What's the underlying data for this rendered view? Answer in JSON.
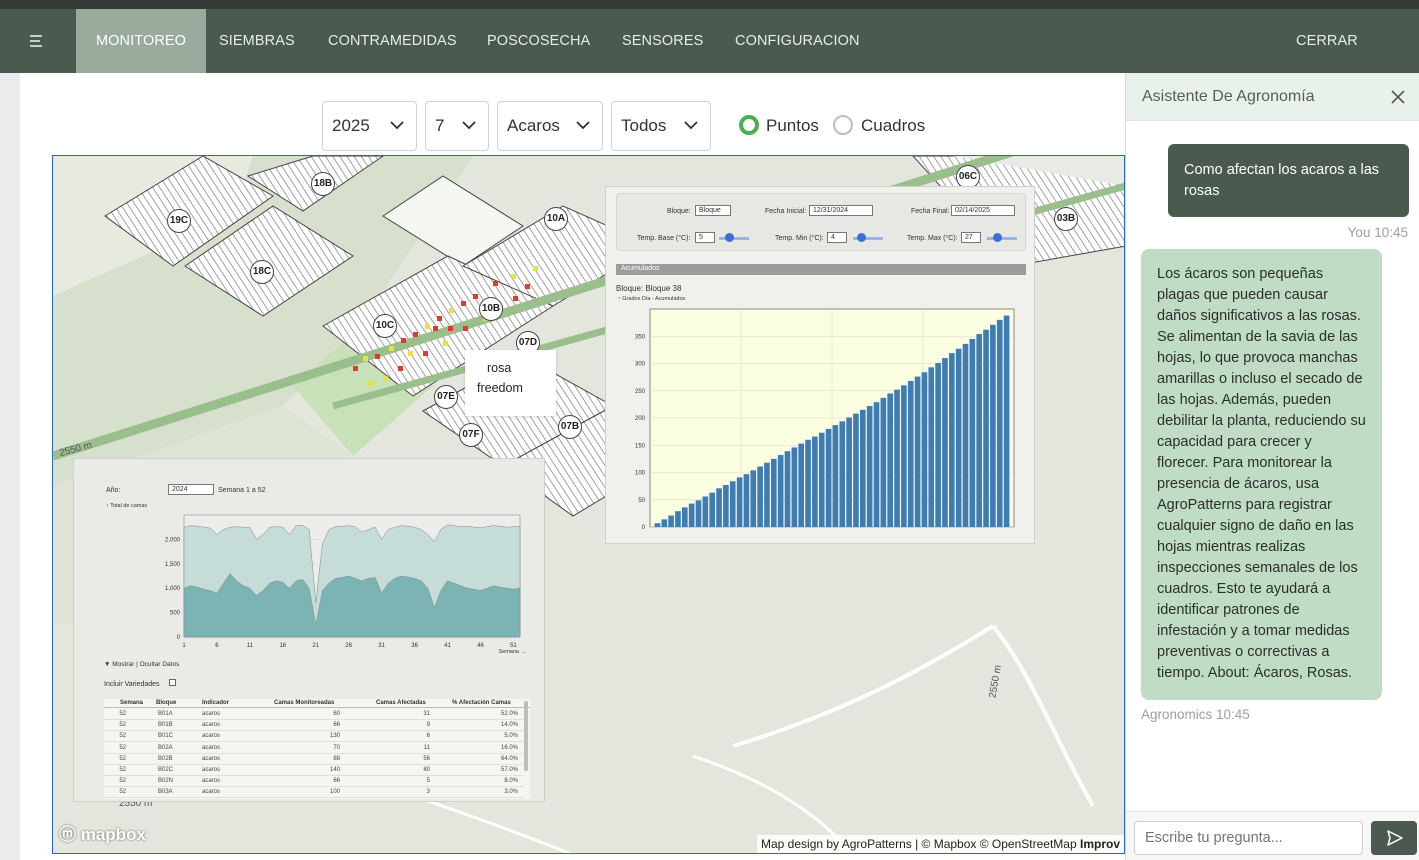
{
  "nav": {
    "menu_icon": "menu-icon",
    "items": [
      {
        "label": "MONITOREO",
        "active": true
      },
      {
        "label": "SIEMBRAS",
        "active": false
      },
      {
        "label": "CONTRAMEDIDAS",
        "active": false
      },
      {
        "label": "POSCOSECHA",
        "active": false
      },
      {
        "label": "SENSORES",
        "active": false
      },
      {
        "label": "CONFIGURACION",
        "active": false
      }
    ],
    "logout_label": "CERRAR SESION"
  },
  "filters": {
    "year": "2025",
    "week": "7",
    "pest": "Acaros",
    "scope": "Todos",
    "view_options": [
      {
        "label": "Puntos",
        "selected": true
      },
      {
        "label": "Cuadros",
        "selected": false
      }
    ]
  },
  "map": {
    "markers": [
      "18B",
      "19C",
      "18C",
      "10A",
      "10C",
      "10B",
      "07D",
      "07E",
      "07F",
      "07B",
      "06C",
      "03B"
    ],
    "popup": {
      "line1": "rosa",
      "line2": "freedom"
    },
    "elevation_labels": [
      "2550 m",
      "2550 m",
      "2550 m"
    ],
    "attribution": "Map design by AgroPatterns | © Mapbox © OpenStreetMap",
    "improve_label": "Improv",
    "logo": "mapbox"
  },
  "gdd_panel": {
    "block_label": "Bloque:",
    "block_value": "Bloque",
    "start_label": "Fecha Inicial:",
    "start_value": "12/31/2024",
    "end_label": "Fecha Final:",
    "end_value": "02/14/2025",
    "tbase_label": "Temp. Base (°C):",
    "tbase_value": "5",
    "tmin_label": "Temp. Min (°C):",
    "tmin_value": "4",
    "tmax_label": "Temp. Max (°C):",
    "tmax_value": "27",
    "section_title": "Acumulados",
    "chart_title": "Bloque: Bloque 38",
    "series_label": "Grados Día - Acumulados"
  },
  "table_panel": {
    "year_label": "Año:",
    "year_value": "2024",
    "range_label": "Semana 1 a 52",
    "series_label": "Total de camas",
    "xaxis_label": "Semana",
    "toggle_label": "Mostrar | Ocultar Datos",
    "include_label": "Incluir Variedades",
    "columns": [
      "Semana",
      "Bloque",
      "Indicador",
      "Camas Monitoreadas",
      "Camas Afectadas",
      "% Afectación Camas"
    ],
    "rows": [
      [
        "52",
        "B01A",
        "acaros",
        "60",
        "31",
        "52.0%"
      ],
      [
        "52",
        "B01B",
        "acaros",
        "66",
        "9",
        "14.0%"
      ],
      [
        "52",
        "B01C",
        "acaros",
        "130",
        "6",
        "5.0%"
      ],
      [
        "52",
        "B02A",
        "acaros",
        "70",
        "11",
        "16.0%"
      ],
      [
        "52",
        "B02B",
        "acaros",
        "88",
        "56",
        "64.0%"
      ],
      [
        "52",
        "B02C",
        "acaros",
        "140",
        "80",
        "57.0%"
      ],
      [
        "52",
        "B02N",
        "acaros",
        "66",
        "5",
        "8.0%"
      ],
      [
        "52",
        "B03A",
        "acaros",
        "100",
        "3",
        "3.0%"
      ]
    ]
  },
  "chart_data": [
    {
      "type": "bar",
      "title": "Bloque: Bloque 38",
      "series": [
        {
          "name": "Grados Día - Acumulados",
          "values": [
            7,
            14,
            21,
            29,
            36,
            43,
            49,
            56,
            63,
            71,
            77,
            84,
            91,
            97,
            104,
            111,
            118,
            125,
            132,
            139,
            146,
            153,
            160,
            166,
            173,
            180,
            187,
            194,
            201,
            208,
            215,
            222,
            229,
            237,
            245,
            252,
            260,
            268,
            276,
            284,
            293,
            301,
            310,
            319,
            327,
            336,
            345,
            354,
            362,
            371,
            380,
            388
          ]
        }
      ],
      "ylim": [
        0,
        400
      ],
      "yticks": [
        0,
        50,
        100,
        150,
        200,
        250,
        300,
        350
      ],
      "grid": true,
      "color": "#3f7cb6"
    },
    {
      "type": "area",
      "series": [
        {
          "name": "Total de camas",
          "values": [
            2250,
            2280,
            2270,
            2250,
            2230,
            2100,
            2200,
            2250,
            2260,
            2250,
            2240,
            2000,
            2100,
            2250,
            2260,
            2250,
            2100,
            2280,
            2290,
            2200,
            700,
            1900,
            2200,
            2260,
            2270,
            2280,
            2260,
            2150,
            2200,
            2250,
            2000,
            2200,
            2250,
            2280,
            2270,
            2250,
            2200,
            2100,
            1950,
            2200,
            2300,
            2280,
            2260,
            2270,
            2250,
            2240,
            2260,
            2280,
            2270,
            2250,
            2260,
            2270
          ]
        },
        {
          "values": [
            1000,
            1050,
            1020,
            980,
            950,
            900,
            1100,
            1300,
            1150,
            1050,
            1000,
            850,
            950,
            1100,
            1150,
            1120,
            1000,
            1150,
            1180,
            1000,
            250,
            950,
            1100,
            1200,
            1220,
            1250,
            1200,
            1150,
            1200,
            1220,
            900,
            1100,
            1200,
            1250,
            1230,
            1200,
            1150,
            1000,
            600,
            950,
            1150,
            1100,
            1050,
            1000,
            980,
            950,
            1000,
            1050,
            1020,
            1000,
            980,
            1000
          ]
        }
      ],
      "ylim": [
        0,
        2500
      ],
      "yticks": [
        "0",
        "500",
        "1,000",
        "1,500",
        "2,000"
      ],
      "xticks": [
        1,
        6,
        11,
        16,
        21,
        26,
        31,
        36,
        41,
        46,
        51
      ],
      "xlabel": "Semana"
    }
  ],
  "assistant": {
    "title": "Asistente De Agronomía",
    "close_icon": "close-icon",
    "user_message": "Como afectan los acaros a las rosas",
    "user_meta": "You 10:45",
    "bot_message": "Los ácaros son pequeñas plagas que pueden causar daños significativos a las rosas. Se alimentan de la savia de las hojas, lo que provoca manchas amarillas o incluso el secado de las hojas. Además, pueden debilitar la planta, reduciendo su capacidad para crecer y florecer. Para monitorear la presencia de ácaros, usa AgroPatterns para registrar cualquier signo de daño en las hojas mientras realizas inspecciones semanales de los cuadros. Esto te ayudará a identificar patrones de infestación y a tomar medidas preventivas o correctivas a tiempo. About: Ácaros, Rosas.",
    "bot_meta": "Agronomics 10:45",
    "input_placeholder": "Escribe tu pregunta...",
    "send_icon": "send-icon"
  }
}
